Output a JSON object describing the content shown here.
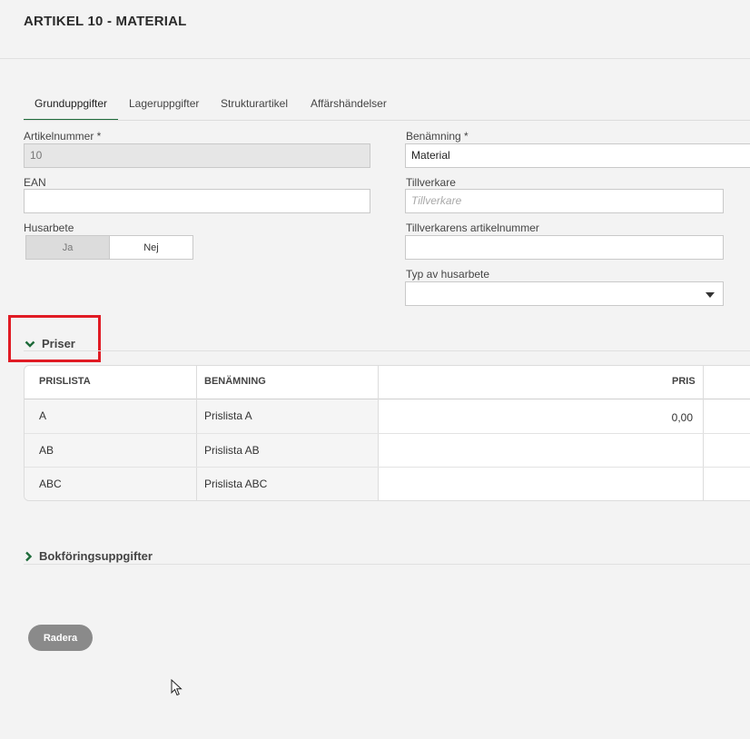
{
  "page": {
    "title": "ARTIKEL 10 - MATERIAL"
  },
  "tabs": [
    {
      "label": "Grunduppgifter",
      "active": true
    },
    {
      "label": "Lageruppgifter"
    },
    {
      "label": "Strukturartikel"
    },
    {
      "label": "Affärshändelser"
    }
  ],
  "form": {
    "artikelnummer": {
      "label": "Artikelnummer *",
      "value": "10"
    },
    "ean": {
      "label": "EAN",
      "value": ""
    },
    "husarbete": {
      "label": "Husarbete",
      "option_ja": "Ja",
      "option_nej": "Nej",
      "selected": "Ja"
    },
    "benamning": {
      "label": "Benämning *",
      "value": "Material"
    },
    "tillverkare": {
      "label": "Tillverkare",
      "placeholder": "Tillverkare"
    },
    "tillverkarens_artikelnummer": {
      "label": "Tillverkarens artikelnummer",
      "value": ""
    },
    "typ_av_husarbete": {
      "label": "Typ av husarbete",
      "value": ""
    }
  },
  "priser": {
    "title": "Priser",
    "columns": [
      "PRISLISTA",
      "BENÄMNING",
      "PRIS"
    ],
    "rows": [
      {
        "prislista": "A",
        "benamning": "Prislista A",
        "pris": "0,00"
      },
      {
        "prislista": "AB",
        "benamning": "Prislista AB",
        "pris": ""
      },
      {
        "prislista": "ABC",
        "benamning": "Prislista ABC",
        "pris": ""
      }
    ]
  },
  "bokforing": {
    "title": "Bokföringsuppgifter"
  },
  "actions": {
    "delete_label": "Radera"
  },
  "colors": {
    "accent": "#1e6b3a",
    "highlight": "#e01b24",
    "button": "#8a8a8a"
  }
}
